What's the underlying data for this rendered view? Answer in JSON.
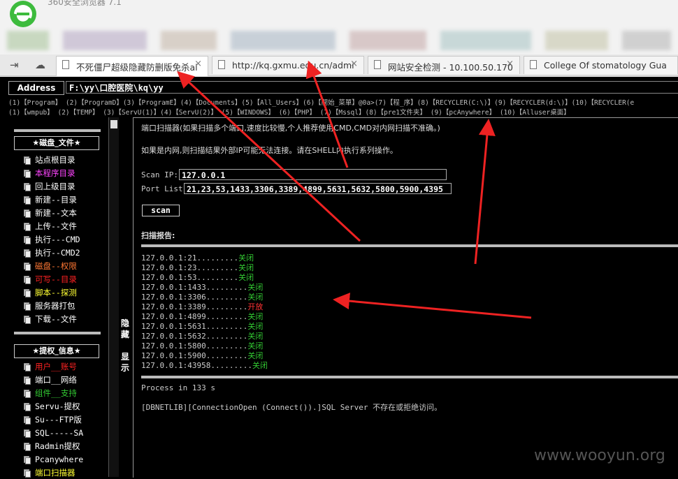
{
  "browser": {
    "title": "360安全浏览器 7.1",
    "tabs": [
      {
        "label": "不死僵尸超级隐藏防删版免杀ai",
        "active": true
      },
      {
        "label": "http://kq.gxmu.edu.cn/admi",
        "active": false
      },
      {
        "label": "网站安全检测 - 10.100.50.170",
        "active": false
      },
      {
        "label": "College Of stomatology Gua",
        "active": false
      }
    ],
    "close_glyph": "×"
  },
  "address": {
    "label": "Address",
    "value": "F:\\yy\\口腔医院\\kq\\yy"
  },
  "paths": {
    "row1": "(1)【Program】 (2)【ProgramD】(3)【ProgramE】(4)【Documents】(5)【All_Users】(6)【開始_菜單】@0a>(7)【程_序】(8)【RECYCLER(C:\\)】(9)【RECYCLER(d:\\)】(10)【RECYCLER(e",
    "row2": "(1)【wmpub】   (2)【TEMP】      (3)【ServU(1)】(4)【ServU(2)】 (5)【WINDOWS】   (6)【PHP】       (7)【Mssql】(8)【pre1文件夹】   (9)【pcAnywhere】 (10)【Alluser桌面】"
  },
  "sidebar": {
    "section1_title": "★磁盘_文件★",
    "section1_items": [
      {
        "label": "站点根目录",
        "color": "#ffffff"
      },
      {
        "label": "本程序目录",
        "color": "#ff44ff"
      },
      {
        "label": "回上级目录",
        "color": "#ffffff"
      },
      {
        "label": "新建--目录",
        "color": "#ffffff"
      },
      {
        "label": "新建--文本",
        "color": "#ffffff"
      },
      {
        "label": "上传--文件",
        "color": "#ffffff"
      },
      {
        "label": "执行---CMD",
        "color": "#ffffff"
      },
      {
        "label": "执行--CMD2",
        "color": "#ffffff"
      },
      {
        "label": "磁盘--权限",
        "color": "#ff7733"
      },
      {
        "label": "可写--目录",
        "color": "#ff2222"
      },
      {
        "label": "脚本--探测",
        "color": "#ffff33"
      },
      {
        "label": "服务器打包",
        "color": "#ffffff"
      },
      {
        "label": "下载--文件",
        "color": "#ffffff"
      }
    ],
    "section2_title": "★提权_信息★",
    "section2_items": [
      {
        "label": "用户__账号",
        "color": "#ff2222"
      },
      {
        "label": "端口__网络",
        "color": "#ffffff"
      },
      {
        "label": "组件__支持",
        "color": "#33cc33"
      },
      {
        "label": "Servu-提权",
        "color": "#ffffff"
      },
      {
        "label": "Su---FTP版",
        "color": "#ffffff"
      },
      {
        "label": "SQL-----SA",
        "color": "#ffffff"
      },
      {
        "label": "Radmin提权",
        "color": "#ffffff"
      },
      {
        "label": "Pcanywhere",
        "color": "#ffffff"
      },
      {
        "label": "端口扫描器",
        "color": "#ffff33"
      }
    ],
    "toggle_label": "隐藏\n\n显示"
  },
  "scanner": {
    "desc1": "端口扫描器(如果扫描多个端口,速度比较慢,个人推荐使用CMD,CMD对内网扫描不准确。)",
    "desc2": "如果是内网,则扫描结果外部IP可能无法连接。请在SHELL内执行系列操作。",
    "ip_label": "Scan IP:",
    "ip_value": "127.0.0.1",
    "ports_label": "Port List:",
    "ports_value": "21,23,53,1433,3306,3389,4899,5631,5632,5800,5900,4395",
    "scan_button": "scan",
    "report_title": "扫描报告:",
    "results": [
      {
        "addr": "127.0.0.1:21.........",
        "status": "关闭",
        "open": false
      },
      {
        "addr": "127.0.0.1:23.........",
        "status": "关闭",
        "open": false
      },
      {
        "addr": "127.0.0.1:53.........",
        "status": "关闭",
        "open": false
      },
      {
        "addr": "127.0.0.1:1433.........",
        "status": "关闭",
        "open": false
      },
      {
        "addr": "127.0.0.1:3306.........",
        "status": "关闭",
        "open": false
      },
      {
        "addr": "127.0.0.1:3389.........",
        "status": "开放",
        "open": true
      },
      {
        "addr": "127.0.0.1:4899.........",
        "status": "关闭",
        "open": false
      },
      {
        "addr": "127.0.0.1:5631.........",
        "status": "关闭",
        "open": false
      },
      {
        "addr": "127.0.0.1:5632.........",
        "status": "关闭",
        "open": false
      },
      {
        "addr": "127.0.0.1:5800.........",
        "status": "关闭",
        "open": false
      },
      {
        "addr": "127.0.0.1:5900.........",
        "status": "关闭",
        "open": false
      },
      {
        "addr": "127.0.0.1:43958.........",
        "status": "关闭",
        "open": false
      }
    ],
    "process_time": "Process in 133 s",
    "sql_error": "[DBNETLIB][ConnectionOpen (Connect()).]SQL Server 不存在或拒绝访问。"
  },
  "watermark": "www.wooyun.org",
  "colors": {
    "annotation_arrow": "#ee2222",
    "closed": "#33cc33",
    "open": "#ff3333"
  }
}
